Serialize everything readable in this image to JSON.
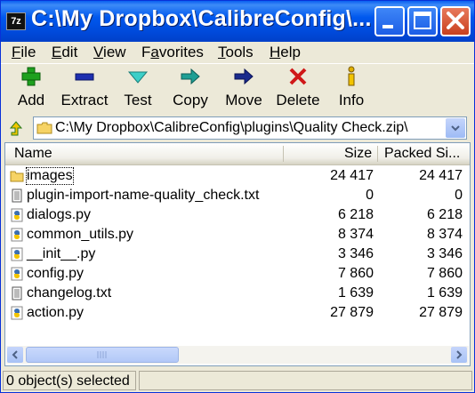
{
  "window": {
    "title": "C:\\My Dropbox\\CalibreConfig\\...",
    "app_icon": "7z"
  },
  "menu": [
    {
      "label": "File",
      "key": "F",
      "rest": "ile"
    },
    {
      "label": "Edit",
      "key": "E",
      "rest": "dit"
    },
    {
      "label": "View",
      "key": "V",
      "rest": "iew"
    },
    {
      "label": "Favorites",
      "key": "a",
      "pre": "F",
      "rest": "vorites"
    },
    {
      "label": "Tools",
      "key": "T",
      "rest": "ools"
    },
    {
      "label": "Help",
      "key": "H",
      "rest": "elp"
    }
  ],
  "toolbar": {
    "add": "Add",
    "extract": "Extract",
    "test": "Test",
    "copy": "Copy",
    "move": "Move",
    "delete": "Delete",
    "info": "Info"
  },
  "address": {
    "path": "C:\\My Dropbox\\CalibreConfig\\plugins\\Quality Check.zip\\"
  },
  "columns": {
    "name": "Name",
    "size": "Size",
    "packed": "Packed Si..."
  },
  "files": [
    {
      "name": "images",
      "size": "24 417",
      "packed": "24 417",
      "type": "folder"
    },
    {
      "name": "plugin-import-name-quality_check.txt",
      "size": "0",
      "packed": "0",
      "type": "txt"
    },
    {
      "name": "dialogs.py",
      "size": "6 218",
      "packed": "6 218",
      "type": "py"
    },
    {
      "name": "common_utils.py",
      "size": "8 374",
      "packed": "8 374",
      "type": "py"
    },
    {
      "name": "__init__.py",
      "size": "3 346",
      "packed": "3 346",
      "type": "py"
    },
    {
      "name": "config.py",
      "size": "7 860",
      "packed": "7 860",
      "type": "py"
    },
    {
      "name": "changelog.txt",
      "size": "1 639",
      "packed": "1 639",
      "type": "txt"
    },
    {
      "name": "action.py",
      "size": "27 879",
      "packed": "27 879",
      "type": "py"
    }
  ],
  "status": {
    "selected": "0 object(s) selected"
  }
}
